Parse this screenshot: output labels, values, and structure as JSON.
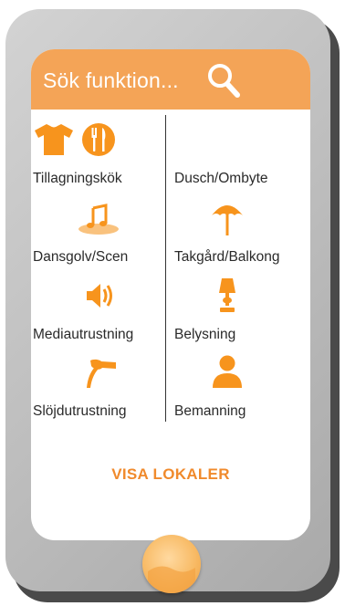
{
  "search": {
    "placeholder_text": "Sök funktion..."
  },
  "functions": {
    "left": [
      {
        "label": "Tillagningskök",
        "icon": "cutlery-icon"
      },
      {
        "label": "Dansgolv/Scen",
        "icon": "music-note-icon"
      },
      {
        "label": "Mediautrustning",
        "icon": "speaker-icon"
      },
      {
        "label": "Slöjdutrustning",
        "icon": "hammer-icon"
      }
    ],
    "right": [
      {
        "label": "Dusch/Ombyte",
        "icon": "tshirt-icon"
      },
      {
        "label": "Takgård/Balkong",
        "icon": "umbrella-icon"
      },
      {
        "label": "Belysning",
        "icon": "lamp-icon"
      },
      {
        "label": "Bemanning",
        "icon": "person-icon"
      }
    ]
  },
  "action": {
    "visa_label": "VISA LOKALER"
  },
  "colors": {
    "accent": "#f4a457",
    "icon": "#f7941d",
    "cta_text": "#f08a2c",
    "phone_body": "#c4c4c4"
  }
}
